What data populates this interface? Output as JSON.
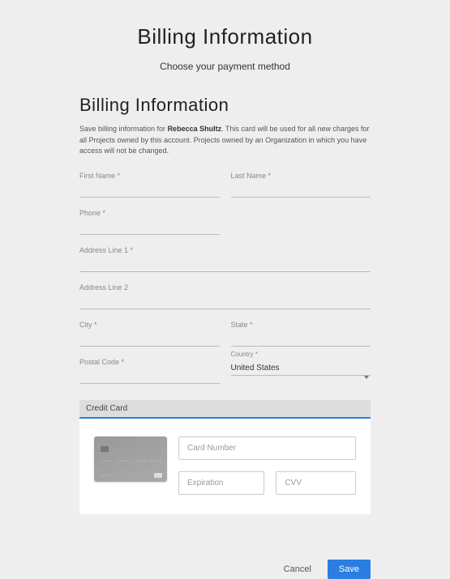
{
  "header": {
    "title": "Billing Information",
    "subtitle": "Choose your payment method"
  },
  "section": {
    "title": "Billing Information",
    "description_prefix": "Save billing information for ",
    "user_name": "Rebecca Shultz",
    "description_suffix": ". This card will be used for all new charges for all Projects owned by this account. Projects owned by an Organization in which you have access will not be changed."
  },
  "form": {
    "first_name": {
      "label": "First Name *",
      "value": ""
    },
    "last_name": {
      "label": "Last Name *",
      "value": ""
    },
    "phone": {
      "label": "Phone *",
      "value": ""
    },
    "address1": {
      "label": "Address Line 1 *",
      "value": ""
    },
    "address2": {
      "label": "Address Line 2",
      "value": ""
    },
    "city": {
      "label": "City *",
      "value": ""
    },
    "state": {
      "label": "State *",
      "value": ""
    },
    "postal": {
      "label": "Postal Code *",
      "value": ""
    },
    "country": {
      "label": "Country *",
      "value": "United States"
    }
  },
  "credit_card": {
    "header": "Credit Card",
    "card_number_placeholder": "Card Number",
    "expiration_placeholder": "Expiration",
    "cvv_placeholder": "CVV"
  },
  "actions": {
    "cancel": "Cancel",
    "save": "Save"
  }
}
